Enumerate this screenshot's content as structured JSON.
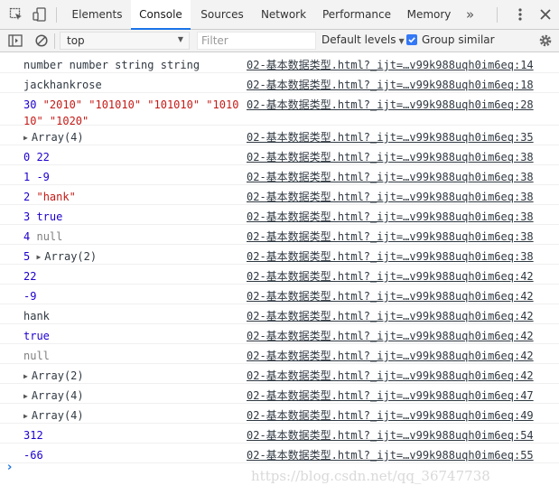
{
  "tabs": {
    "items": [
      "Elements",
      "Console",
      "Sources",
      "Network",
      "Performance",
      "Memory"
    ],
    "more": "»",
    "active_index": 1
  },
  "toolbar": {
    "context_value": "top",
    "filter_placeholder": "Filter",
    "levels_label": "Default levels",
    "group_similar_label": "Group similar",
    "group_similar_checked": true
  },
  "messages": [
    {
      "text": "number number string string",
      "kind": "plain",
      "source": "02-基本数据类型.html?_ijt=…v99k988uqh0im6eq:14"
    },
    {
      "text": "jackhankrose",
      "kind": "plain",
      "source": "02-基本数据类型.html?_ijt=…v99k988uqh0im6eq:18"
    },
    {
      "text": "30 \"2010\" \"101010\" \"101010\" \"101010\" \"1020\"",
      "kind": "mixed",
      "source": "02-基本数据类型.html?_ijt=…v99k988uqh0im6eq:28"
    },
    {
      "text": "Array(4)",
      "kind": "array",
      "source": "02-基本数据类型.html?_ijt=…v99k988uqh0im6eq:35"
    },
    {
      "text": "0 22",
      "kind": "num",
      "source": "02-基本数据类型.html?_ijt=…v99k988uqh0im6eq:38"
    },
    {
      "text": "1 -9",
      "kind": "num",
      "source": "02-基本数据类型.html?_ijt=…v99k988uqh0im6eq:38"
    },
    {
      "text": "2 \"hank\"",
      "kind": "index-str",
      "source": "02-基本数据类型.html?_ijt=…v99k988uqh0im6eq:38"
    },
    {
      "text": "3 true",
      "kind": "num",
      "source": "02-基本数据类型.html?_ijt=…v99k988uqh0im6eq:38"
    },
    {
      "text": "4 null",
      "kind": "index-null",
      "source": "02-基本数据类型.html?_ijt=…v99k988uqh0im6eq:38"
    },
    {
      "text": "5 Array(2)",
      "kind": "index-array",
      "source": "02-基本数据类型.html?_ijt=…v99k988uqh0im6eq:38"
    },
    {
      "text": "22",
      "kind": "num",
      "source": "02-基本数据类型.html?_ijt=…v99k988uqh0im6eq:42"
    },
    {
      "text": "-9",
      "kind": "num",
      "source": "02-基本数据类型.html?_ijt=…v99k988uqh0im6eq:42"
    },
    {
      "text": "hank",
      "kind": "plain",
      "source": "02-基本数据类型.html?_ijt=…v99k988uqh0im6eq:42"
    },
    {
      "text": "true",
      "kind": "num",
      "source": "02-基本数据类型.html?_ijt=…v99k988uqh0im6eq:42"
    },
    {
      "text": "null",
      "kind": "null",
      "source": "02-基本数据类型.html?_ijt=…v99k988uqh0im6eq:42"
    },
    {
      "text": "Array(2)",
      "kind": "array",
      "source": "02-基本数据类型.html?_ijt=…v99k988uqh0im6eq:42"
    },
    {
      "text": "Array(4)",
      "kind": "array",
      "source": "02-基本数据类型.html?_ijt=…v99k988uqh0im6eq:47"
    },
    {
      "text": "Array(4)",
      "kind": "array",
      "source": "02-基本数据类型.html?_ijt=…v99k988uqh0im6eq:49"
    },
    {
      "text": "312",
      "kind": "num",
      "source": "02-基本数据类型.html?_ijt=…v99k988uqh0im6eq:54"
    },
    {
      "text": "-66",
      "kind": "num",
      "source": "02-基本数据类型.html?_ijt=…v99k988uqh0im6eq:55"
    }
  ],
  "prompt_symbol": "›",
  "watermark": "https://blog.csdn.net/qq_36747738",
  "icons": {
    "inspect": "element-picker-icon",
    "device": "device-toolbar-icon",
    "kebab": "more-options-icon",
    "close": "close-devtools-icon",
    "sidebar": "console-sidebar-icon",
    "clear": "clear-console-icon",
    "settings": "console-settings-icon"
  },
  "colors": {
    "accent": "#1a73e8",
    "number": "#1c00cf",
    "string": "#c41a16",
    "null": "#808080",
    "checkbox": "#3478f6"
  }
}
